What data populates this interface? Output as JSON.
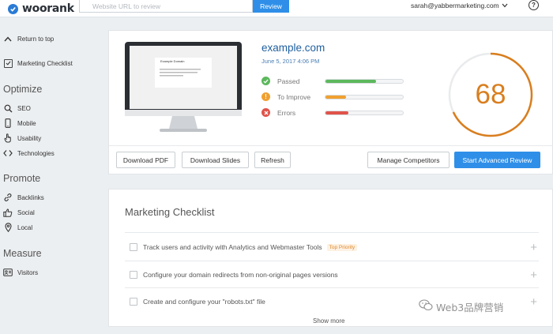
{
  "header": {
    "logo_text": "woorank",
    "url_placeholder": "Website URL to review",
    "review_label": "Review",
    "user_email": "sarah@yabbermarketing.com",
    "help_label": "?"
  },
  "sidebar": {
    "return_label": "Return to top",
    "checklist_label": "Marketing Checklist",
    "sections": [
      {
        "heading": "Optimize",
        "items": [
          "SEO",
          "Mobile",
          "Usability",
          "Technologies"
        ]
      },
      {
        "heading": "Promote",
        "items": [
          "Backlinks",
          "Social",
          "Local"
        ]
      },
      {
        "heading": "Measure",
        "items": [
          "Visitors"
        ]
      }
    ]
  },
  "overview": {
    "site": "example.com",
    "date": "June 5, 2017 4:06 PM",
    "preview_heading": "Example Domain",
    "score": "68",
    "score_fraction": 0.68,
    "stats": [
      {
        "label": "Passed",
        "fill_fraction": 0.65,
        "color": "#5cb85c",
        "icon": "check-icon"
      },
      {
        "label": "To Improve",
        "fill_fraction": 0.27,
        "color": "#f0a030",
        "icon": "exclamation-icon"
      },
      {
        "label": "Errors",
        "fill_fraction": 0.3,
        "color": "#e0534a",
        "icon": "x-icon"
      }
    ],
    "buttons": {
      "download_pdf": "Download PDF",
      "download_slides": "Download Slides",
      "refresh": "Refresh",
      "manage_competitors": "Manage Competitors",
      "start_advanced": "Start Advanced Review"
    }
  },
  "checklist": {
    "title": "Marketing Checklist",
    "items": [
      {
        "text": "Track users and activity with Analytics and Webmaster Tools",
        "badge": "Top Priority"
      },
      {
        "text": "Configure your domain redirects from non-original pages versions",
        "badge": ""
      },
      {
        "text": "Create and configure your \"robots.txt\" file",
        "badge": ""
      }
    ],
    "show_more": "Show more"
  },
  "watermark": {
    "text": "Web3品牌营销"
  },
  "colors": {
    "brand_blue": "#2f8fe8",
    "score_orange": "#d97e1e",
    "title_blue": "#1f5f9f"
  }
}
